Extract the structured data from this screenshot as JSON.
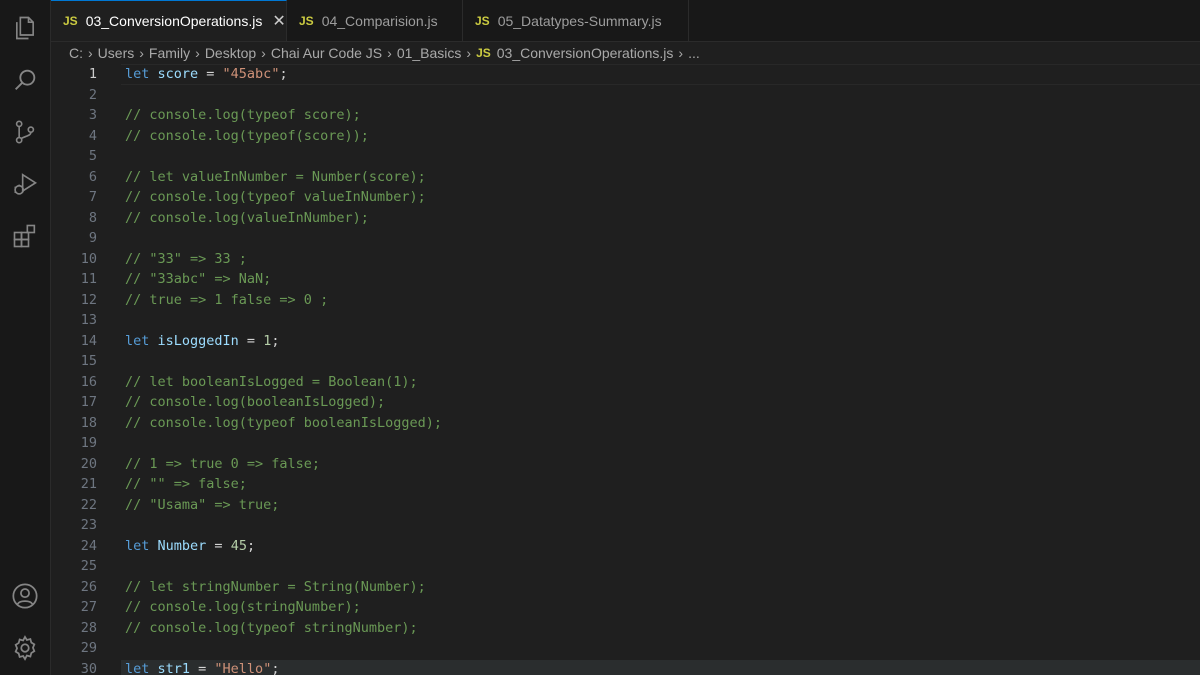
{
  "tabs": [
    {
      "badge": "JS",
      "label": "03_ConversionOperations.js",
      "close": "✕"
    },
    {
      "badge": "JS",
      "label": "04_Comparision.js"
    },
    {
      "badge": "JS",
      "label": "05_Datatypes-Summary.js"
    }
  ],
  "breadcrumb": {
    "parts": [
      "C:",
      "Users",
      "Family",
      "Desktop",
      "Chai Aur Code JS",
      "01_Basics"
    ],
    "file_badge": "JS",
    "file": "03_ConversionOperations.js",
    "more": "..."
  },
  "editor": {
    "current_line": 1,
    "lines": [
      {
        "n": "1",
        "t": [
          [
            "kw",
            "let "
          ],
          [
            "var",
            "score"
          ],
          [
            "op",
            " = "
          ],
          [
            "str",
            "\"45abc\""
          ],
          [
            "op",
            ";"
          ]
        ]
      },
      {
        "n": "2",
        "t": []
      },
      {
        "n": "3",
        "t": [
          [
            "cm",
            "// console.log(typeof score);"
          ]
        ]
      },
      {
        "n": "4",
        "t": [
          [
            "cm",
            "// console.log(typeof(score));"
          ]
        ]
      },
      {
        "n": "5",
        "t": []
      },
      {
        "n": "6",
        "t": [
          [
            "cm",
            "// let valueInNumber = Number(score);"
          ]
        ]
      },
      {
        "n": "7",
        "t": [
          [
            "cm",
            "// console.log(typeof valueInNumber);"
          ]
        ]
      },
      {
        "n": "8",
        "t": [
          [
            "cm",
            "// console.log(valueInNumber);"
          ]
        ]
      },
      {
        "n": "9",
        "t": []
      },
      {
        "n": "10",
        "t": [
          [
            "cm",
            "// \"33\" => 33 ;"
          ]
        ]
      },
      {
        "n": "11",
        "t": [
          [
            "cm",
            "// \"33abc\" => NaN;"
          ]
        ]
      },
      {
        "n": "12",
        "t": [
          [
            "cm",
            "// true => 1 false => 0 ;"
          ]
        ]
      },
      {
        "n": "13",
        "t": []
      },
      {
        "n": "14",
        "t": [
          [
            "kw",
            "let "
          ],
          [
            "var",
            "isLoggedIn"
          ],
          [
            "op",
            " = "
          ],
          [
            "numv",
            "1"
          ],
          [
            "op",
            ";"
          ]
        ]
      },
      {
        "n": "15",
        "t": []
      },
      {
        "n": "16",
        "t": [
          [
            "cm",
            "// let booleanIsLogged = Boolean(1);"
          ]
        ]
      },
      {
        "n": "17",
        "t": [
          [
            "cm",
            "// console.log(booleanIsLogged);"
          ]
        ]
      },
      {
        "n": "18",
        "t": [
          [
            "cm",
            "// console.log(typeof booleanIsLogged);"
          ]
        ]
      },
      {
        "n": "19",
        "t": []
      },
      {
        "n": "20",
        "t": [
          [
            "cm",
            "// 1 => true 0 => false;"
          ]
        ]
      },
      {
        "n": "21",
        "t": [
          [
            "cm",
            "// \"\" => false;"
          ]
        ]
      },
      {
        "n": "22",
        "t": [
          [
            "cm",
            "// \"Usama\" => true;"
          ]
        ]
      },
      {
        "n": "23",
        "t": []
      },
      {
        "n": "24",
        "t": [
          [
            "kw",
            "let "
          ],
          [
            "var",
            "Number"
          ],
          [
            "op",
            " = "
          ],
          [
            "numv",
            "45"
          ],
          [
            "op",
            ";"
          ]
        ]
      },
      {
        "n": "25",
        "t": []
      },
      {
        "n": "26",
        "t": [
          [
            "cm",
            "// let stringNumber = String(Number);"
          ]
        ]
      },
      {
        "n": "27",
        "t": [
          [
            "cm",
            "// console.log(stringNumber);"
          ]
        ]
      },
      {
        "n": "28",
        "t": [
          [
            "cm",
            "// console.log(typeof stringNumber);"
          ]
        ]
      },
      {
        "n": "29",
        "t": []
      },
      {
        "n": "30",
        "t": [
          [
            "kw",
            "let "
          ],
          [
            "var",
            "str1"
          ],
          [
            "op",
            " = "
          ],
          [
            "str",
            "\"Hello\""
          ],
          [
            "op",
            ";"
          ]
        ]
      }
    ]
  },
  "activity_bar": {
    "top": [
      "explorer-icon",
      "search-icon",
      "source-control-icon",
      "run-debug-icon",
      "extensions-icon"
    ],
    "bottom": [
      "accounts-icon",
      "settings-gear-icon"
    ]
  },
  "colors": {
    "background": "#1f1f1f",
    "keyword": "#569cd6",
    "variable": "#9cdcfe",
    "string": "#ce9178",
    "number": "#b5cea8",
    "comment": "#6a9955",
    "js_badge": "#cbcb41",
    "active_tab_border": "#0078d4"
  }
}
